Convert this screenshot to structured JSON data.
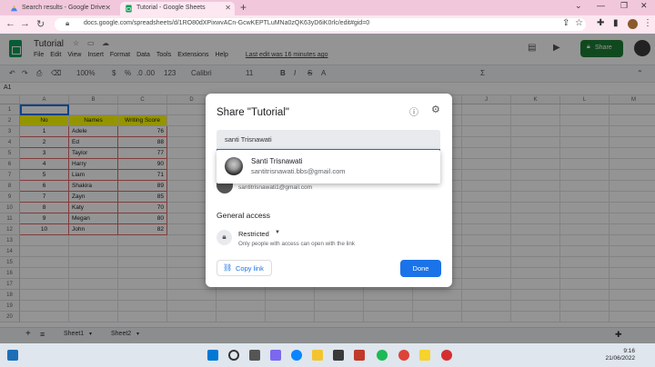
{
  "browser": {
    "tabs": [
      {
        "label": "Search results - Google Drive",
        "active": false
      },
      {
        "label": "Tutorial - Google Sheets",
        "active": true
      }
    ],
    "url": "docs.google.com/spreadsheets/d/1RO80dXPixwvACn-GcwKEPTLuMNa0zQK63yD6iK0rlc/edit#gid=0"
  },
  "sheets": {
    "doc_title": "Tutorial",
    "menu": [
      "File",
      "Edit",
      "View",
      "Insert",
      "Format",
      "Data",
      "Tools",
      "Extensions",
      "Help"
    ],
    "last_edit": "Last edit was 16 minutes ago",
    "share_label": "Share",
    "toolbar": {
      "zoom": "100%",
      "currency": "$",
      "percent": "%",
      "decimals": ".0  .00",
      "format": "123",
      "font": "Calibri",
      "font_size": "11",
      "bold": "B",
      "italic": "I",
      "strike": "S",
      "text_color": "A"
    },
    "cell_ref": "A1",
    "columns": [
      "A",
      "B",
      "C",
      "D",
      "E",
      "F",
      "G",
      "H",
      "I",
      "J",
      "K",
      "L",
      "M"
    ],
    "row_numbers": [
      "1",
      "2",
      "3",
      "4",
      "5",
      "6",
      "7",
      "8",
      "9",
      "10",
      "11",
      "12",
      "13",
      "14",
      "15",
      "16",
      "17",
      "18",
      "19",
      "20"
    ],
    "table_headers": [
      "No",
      "Names",
      "Writing Score"
    ],
    "table_rows": [
      [
        "1",
        "Adele",
        "76"
      ],
      [
        "2",
        "Ed",
        "88"
      ],
      [
        "3",
        "Taylor",
        "77"
      ],
      [
        "4",
        "Harry",
        "90"
      ],
      [
        "5",
        "Liam",
        "71"
      ],
      [
        "6",
        "Shakira",
        "89"
      ],
      [
        "7",
        "Zayn",
        "85"
      ],
      [
        "8",
        "Katy",
        "70"
      ],
      [
        "9",
        "Megan",
        "80"
      ],
      [
        "10",
        "John",
        "82"
      ]
    ],
    "sheet_tabs": [
      "Sheet1",
      "Sheet2"
    ]
  },
  "share_dialog": {
    "title": "Share \"Tutorial\"",
    "input_value": "santi Trisnawati",
    "suggestion": {
      "name": "Santi Trisnawati",
      "email": "santitrisnawati.bbs@gmail.com"
    },
    "owner_email": "santitrisnawati1@gmail.com",
    "owner_role": "Owner",
    "general_access_title": "General access",
    "access_level": "Restricted",
    "access_description": "Only people with access can open with the link",
    "copy_link_label": "Copy link",
    "done_label": "Done"
  },
  "taskbar": {
    "time": "9:16",
    "date": "21/06/2022"
  },
  "colors": {
    "accent": "#1a73e8",
    "share_green": "#1e7e34",
    "header_yellow": "#ffff00",
    "chrome_pink": "#f1c7dc"
  }
}
